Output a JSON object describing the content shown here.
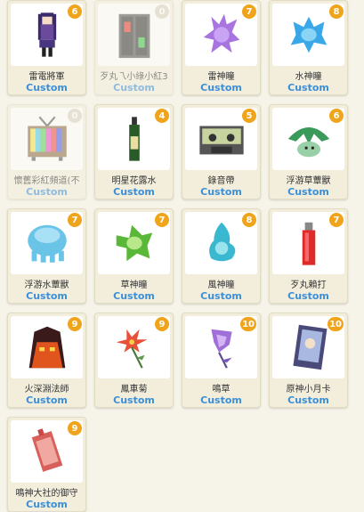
{
  "items": [
    {
      "name": "雷電將軍",
      "count": "6",
      "tag": "Custom",
      "icon": "raiden-shogun-icon"
    },
    {
      "name": "歹丸乁小綠小紅3",
      "count": "0",
      "tag": "Custom",
      "icon": "traffic-light-icon"
    },
    {
      "name": "雷神瞳",
      "count": "7",
      "tag": "Custom",
      "icon": "electroculus-icon"
    },
    {
      "name": "水神瞳",
      "count": "8",
      "tag": "Custom",
      "icon": "hydroculus-icon"
    },
    {
      "name": "懷舊彩紅頻道(不",
      "count": "0",
      "tag": "Custom",
      "icon": "retro-tv-icon"
    },
    {
      "name": "明星花露水",
      "count": "4",
      "tag": "Custom",
      "icon": "perfume-bottle-icon"
    },
    {
      "name": "錄音帶",
      "count": "5",
      "tag": "Custom",
      "icon": "cassette-tape-icon"
    },
    {
      "name": "浮游草蕈獸",
      "count": "6",
      "tag": "Custom",
      "icon": "grass-slime-icon"
    },
    {
      "name": "浮游水蕈獸",
      "count": "7",
      "tag": "Custom",
      "icon": "water-slime-icon"
    },
    {
      "name": "草神瞳",
      "count": "7",
      "tag": "Custom",
      "icon": "dendroculus-icon"
    },
    {
      "name": "風神瞳",
      "count": "8",
      "tag": "Custom",
      "icon": "anemoculus-icon"
    },
    {
      "name": "歹丸賴打",
      "count": "7",
      "tag": "Custom",
      "icon": "lighter-icon"
    },
    {
      "name": "火深淵法師",
      "count": "9",
      "tag": "Custom",
      "icon": "abyss-mage-icon"
    },
    {
      "name": "鳳車菊",
      "count": "9",
      "tag": "Custom",
      "icon": "flower-icon"
    },
    {
      "name": "鳴草",
      "count": "10",
      "tag": "Custom",
      "icon": "naku-weed-icon"
    },
    {
      "name": "原神小月卡",
      "count": "10",
      "tag": "Custom",
      "icon": "moon-card-icon"
    },
    {
      "name": "鳴神大社的御守",
      "count": "9",
      "tag": "Custom",
      "icon": "omamori-icon"
    }
  ]
}
